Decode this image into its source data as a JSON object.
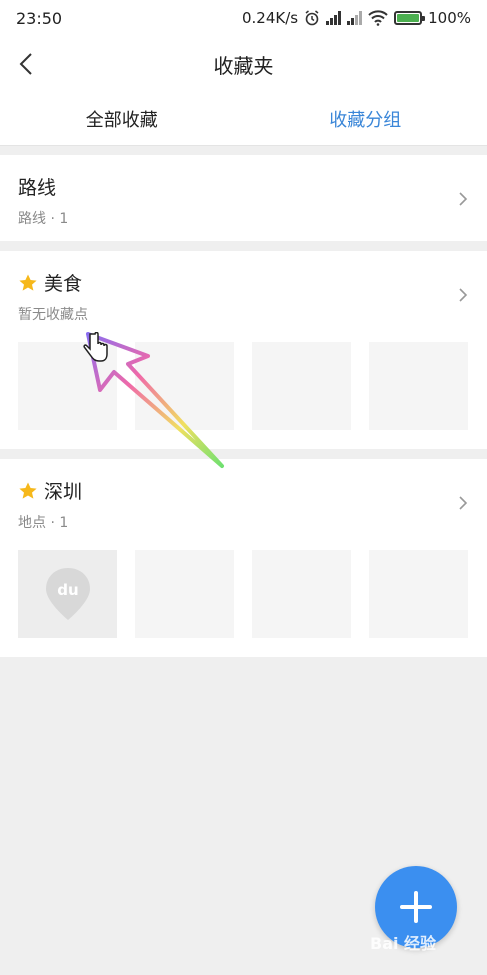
{
  "status": {
    "time": "23:50",
    "speed": "0.24K/s",
    "battery": "100%"
  },
  "nav": {
    "title": "收藏夹"
  },
  "tabs": [
    {
      "label": "全部收藏",
      "active": false
    },
    {
      "label": "收藏分组",
      "active": true
    }
  ],
  "groups": [
    {
      "title": "路线",
      "subtitle": "路线 · 1"
    },
    {
      "title": "美食",
      "subtitle": "暂无收藏点"
    },
    {
      "title": "深圳",
      "subtitle": "地点 · 1"
    }
  ],
  "thumb_logo_text": "du",
  "watermark": "Bai 经验",
  "colors": {
    "accent": "#3a86d8",
    "fab": "#3b8ff0",
    "star": "#f6b81b"
  }
}
